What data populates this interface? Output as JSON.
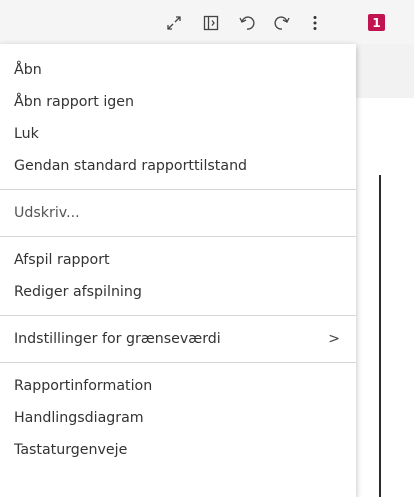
{
  "toolbar": {
    "icons": [
      "expand-icon",
      "side-panel-icon",
      "undo-icon",
      "redo-icon",
      "more-options-icon"
    ],
    "badge_count": "1",
    "badge_color": "#c1134f"
  },
  "menu": {
    "groups": [
      [
        "Åbn",
        "Åbn rapport igen",
        "Luk",
        "Gendan standard rapporttilstand"
      ],
      [
        "Udskriv..."
      ],
      [
        "Afspil rapport",
        "Rediger afspilning"
      ],
      [
        "Indstillinger for grænseværdi"
      ],
      [
        "Rapportinformation",
        "Handlingsdiagram",
        "Tastaturgenveje"
      ]
    ],
    "submenu_indicator": ">"
  }
}
